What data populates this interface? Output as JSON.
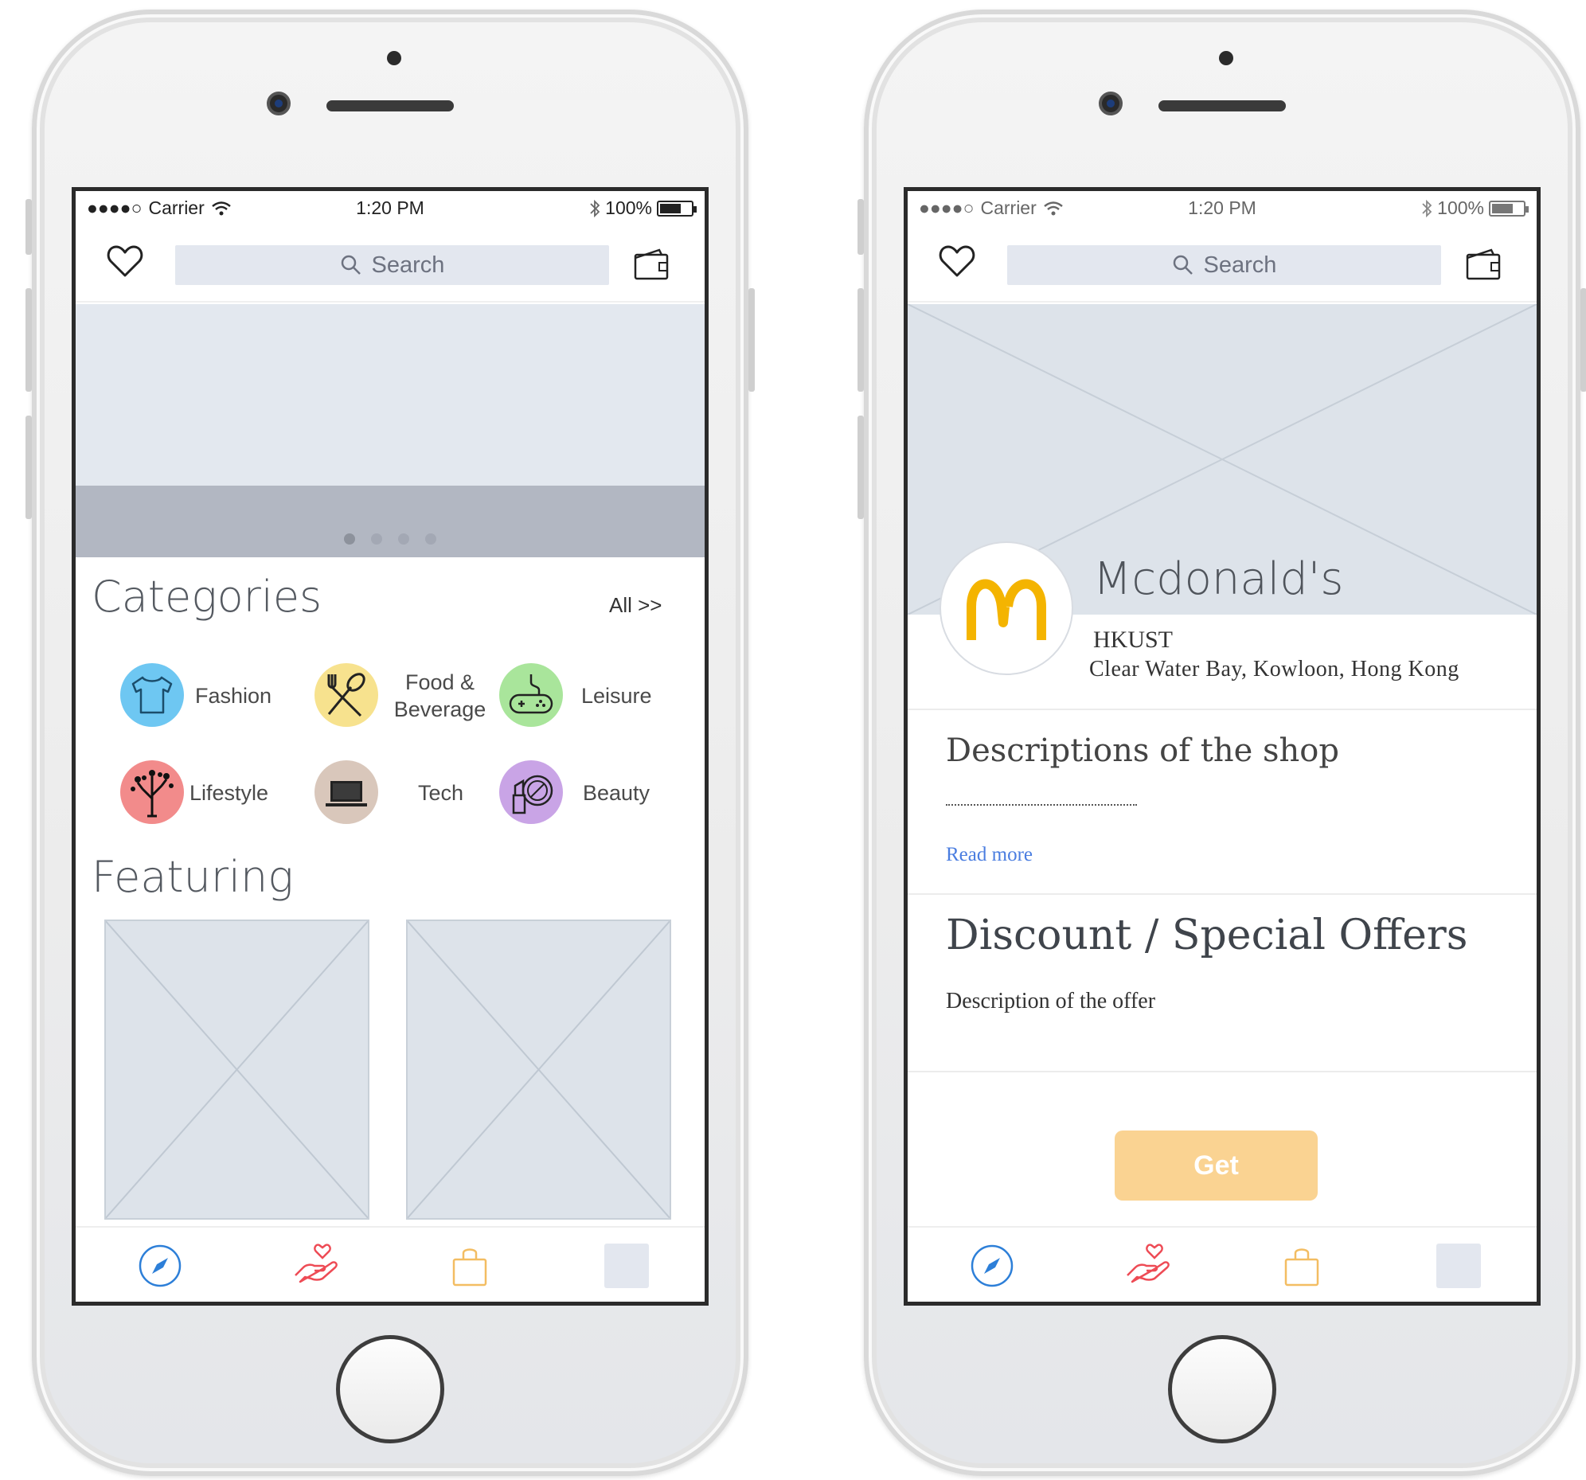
{
  "status_bar": {
    "carrier": "Carrier",
    "time": "1:20 PM",
    "battery": "100%"
  },
  "search": {
    "placeholder": "Search"
  },
  "home": {
    "categories_title": "Categories",
    "all_link": "All >>",
    "categories": [
      {
        "label": "Fashion",
        "color": "#6ec7f2",
        "icon": "t-shirt-icon"
      },
      {
        "label_line1": "Food &",
        "label_line2": "Beverage",
        "color": "#f7e28e",
        "icon": "fork-spoon-icon"
      },
      {
        "label": "Leisure",
        "color": "#a9e59b",
        "icon": "gamepad-icon"
      },
      {
        "label": "Lifestyle",
        "color": "#f28b8b",
        "icon": "tree-person-icon"
      },
      {
        "label": "Tech",
        "color": "#d9c7bb",
        "icon": "laptop-icon"
      },
      {
        "label": "Beauty",
        "color": "#c9a4e6",
        "icon": "lipstick-icon"
      }
    ],
    "featuring_title": "Featuring",
    "banner_pages": 4,
    "banner_active_index": 0
  },
  "shop": {
    "name": "Mcdonald's",
    "area": "HKUST",
    "address": "Clear Water Bay, Kowloon, Hong Kong",
    "description_title": "Descriptions of the shop",
    "read_more": "Read more",
    "offer_title": "Discount / Special Offers",
    "offer_description": "Description of the offer",
    "get_button": "Get",
    "logo_color": "#f4b400"
  },
  "tab_bar": {
    "items": [
      "compass-icon",
      "hand-heart-icon",
      "shopping-bag-icon",
      "profile-placeholder-icon"
    ],
    "colors": {
      "compass": "#2d7fd8",
      "hand_heart": "#ee4b55",
      "bag": "#f3bd62",
      "profile": "#e3e7ef"
    }
  }
}
